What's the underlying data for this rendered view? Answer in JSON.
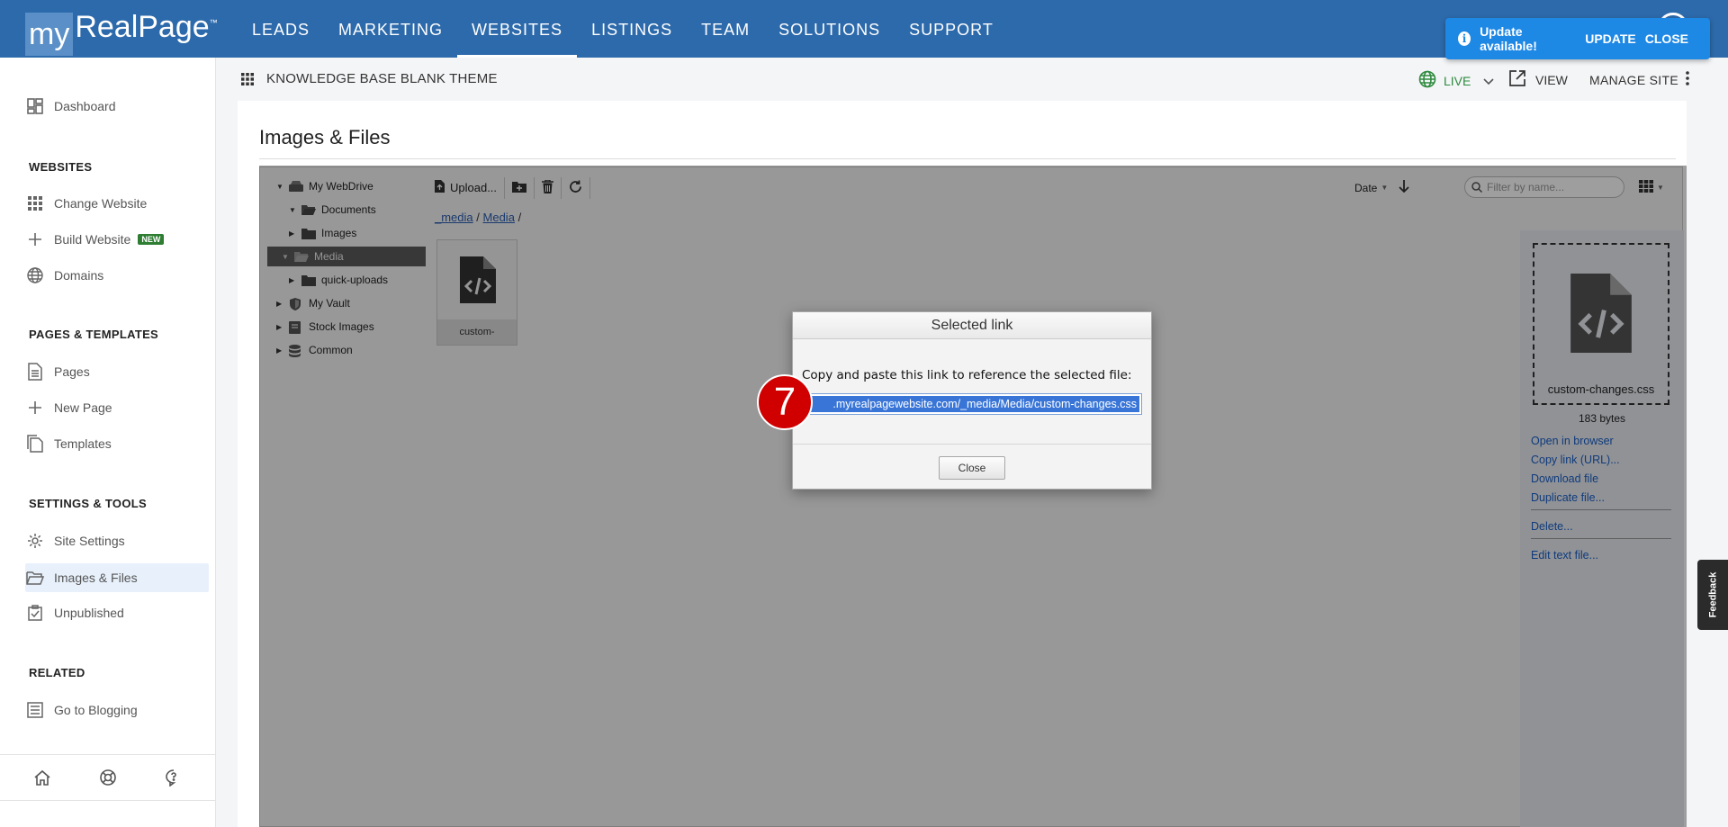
{
  "logo": {
    "my": "my",
    "realpage": "RealPage",
    "tm": "™"
  },
  "nav": [
    "LEADS",
    "MARKETING",
    "WEBSITES",
    "LISTINGS",
    "TEAM",
    "SOLUTIONS",
    "SUPPORT"
  ],
  "update": {
    "message": "Update available!",
    "update_label": "UPDATE",
    "close_label": "CLOSE",
    "info_icon": "info-icon"
  },
  "sidebar": {
    "dashboard": "Dashboard",
    "websites_header": "WEBSITES",
    "change_website": "Change Website",
    "build_website": "Build Website",
    "new_badge": "NEW",
    "domains": "Domains",
    "pages_header": "PAGES & TEMPLATES",
    "pages": "Pages",
    "new_page": "New Page",
    "templates": "Templates",
    "settings_header": "SETTINGS & TOOLS",
    "site_settings": "Site Settings",
    "images_files": "Images & Files",
    "unpublished": "Unpublished",
    "related_header": "RELATED",
    "go_blogging": "Go to Blogging",
    "footer_icons": [
      "home-icon",
      "lifebuoy-icon",
      "chat-help-icon"
    ]
  },
  "subbar": {
    "theme": "KNOWLEDGE BASE BLANK THEME",
    "live": "LIVE",
    "view": "VIEW",
    "manage": "MANAGE SITE"
  },
  "panel": {
    "title": "Images & Files"
  },
  "tree": {
    "webdrive": "My WebDrive",
    "documents": "Documents",
    "images": "Images",
    "media": "Media",
    "quick_uploads": "quick-uploads",
    "vault": "My Vault",
    "stock": "Stock Images",
    "common": "Common"
  },
  "toolbar": {
    "upload": "Upload...",
    "sort": "Date",
    "filter_placeholder": "Filter by name..."
  },
  "breadcrumb": {
    "root": "_media",
    "sep1": "/",
    "media": "Media",
    "sep2": "/"
  },
  "file_tile": {
    "name": "custom-"
  },
  "details": {
    "filename": "custom-changes.css",
    "size": "183 bytes",
    "open": "Open in browser",
    "copy": "Copy link (URL)...",
    "download": "Download file",
    "duplicate": "Duplicate file...",
    "delete": "Delete...",
    "edit": "Edit text file..."
  },
  "dialog": {
    "title": "Selected link",
    "text": "Copy and paste this link to reference the selected file:",
    "link": ".myrealpagewebsite.com/_media/Media/custom-changes.css",
    "close": "Close"
  },
  "step_number": "7",
  "feedback": "Feedback",
  "colors": {
    "brand": "#2d6aab",
    "update": "#1e88e5",
    "live": "#2e8b3e",
    "step": "#d10000"
  }
}
